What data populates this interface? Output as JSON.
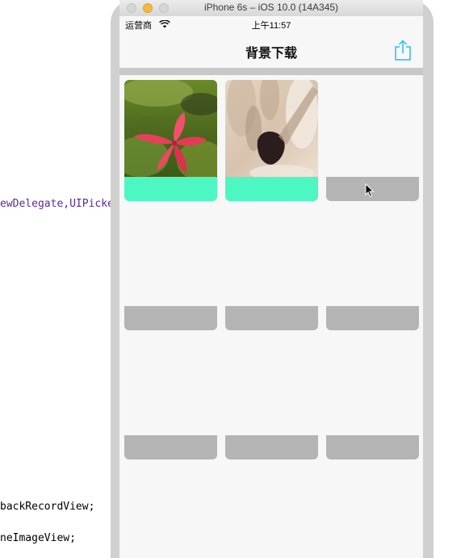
{
  "editor": {
    "lines": [
      {
        "text": "ewDelegate,UIPicker",
        "color": "purple"
      },
      {
        "text": "backRecordView;",
        "color": "black"
      },
      {
        "text": "neImageView;",
        "color": "black"
      }
    ]
  },
  "simulator": {
    "title": "iPhone 6s – iOS 10.0 (14A345)"
  },
  "status_bar": {
    "carrier": "运营商",
    "time": "上午11:57"
  },
  "nav": {
    "title": "背景下载",
    "share_icon": "share-icon"
  },
  "colors": {
    "accent": "#2bbcf0",
    "downloaded": "#4cf7c2",
    "pending": "#b4b4b4"
  },
  "grid": {
    "cells": [
      {
        "status": "downloaded",
        "image": "red-flower"
      },
      {
        "status": "downloaded",
        "image": "makeup-brush"
      },
      {
        "status": "pending",
        "image": ""
      },
      {
        "status": "pending",
        "image": ""
      },
      {
        "status": "pending",
        "image": ""
      },
      {
        "status": "pending",
        "image": ""
      },
      {
        "status": "pending",
        "image": ""
      },
      {
        "status": "pending",
        "image": ""
      },
      {
        "status": "pending",
        "image": ""
      }
    ]
  }
}
